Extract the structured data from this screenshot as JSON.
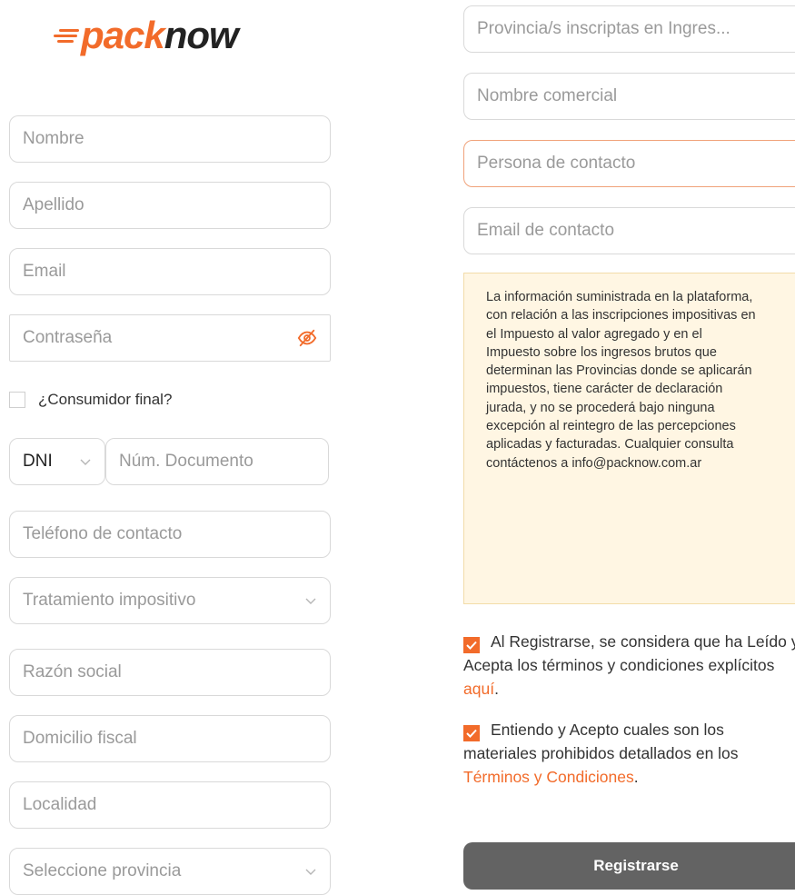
{
  "brand": {
    "logo_pack": "pack",
    "logo_now": "now",
    "accent": "#f26b2a"
  },
  "left_form": {
    "nombre_placeholder": "Nombre",
    "apellido_placeholder": "Apellido",
    "email_placeholder": "Email",
    "password_placeholder": "Contraseña",
    "consumidor_final_label": "¿Consumidor final?",
    "doc_type_value": "DNI",
    "doc_number_placeholder": "Núm. Documento",
    "telefono_placeholder": "Teléfono de contacto",
    "tratamiento_placeholder": "Tratamiento impositivo",
    "razon_social_placeholder": "Razón social",
    "domicilio_placeholder": "Domicilio fiscal",
    "localidad_placeholder": "Localidad",
    "provincia_placeholder": "Seleccione provincia"
  },
  "right_form": {
    "provincias_iibb_placeholder": "Provincia/s inscriptas en Ingres...",
    "nombre_comercial_placeholder": "Nombre comercial",
    "persona_contacto_placeholder": "Persona de contacto",
    "email_contacto_placeholder": "Email de contacto"
  },
  "notice": {
    "text": "La información suministrada en la plataforma, con relación a las inscripciones impositivas en el Impuesto al valor agregado y en el Impuesto sobre los ingresos brutos que determinan las Provincias donde se aplicarán impuestos, tiene carácter de declaración jurada, y no se procederá bajo ninguna excepción al reintegro de las percepciones aplicadas y facturadas. Cualquier consulta contáctenos a info@packnow.com.ar"
  },
  "consents": {
    "terms_text": "Al Registrarse, se considera que ha Leído y Acepta los términos y condiciones explícitos ",
    "terms_link": "aquí",
    "terms_after": ".",
    "terms_checked": true,
    "prohibited_text": "Entiendo y Acepto cuales son los materiales prohibidos detallados en los ",
    "prohibited_link": "Términos y Condiciones",
    "prohibited_after": ".",
    "prohibited_checked": true
  },
  "submit_label": "Registrarse"
}
